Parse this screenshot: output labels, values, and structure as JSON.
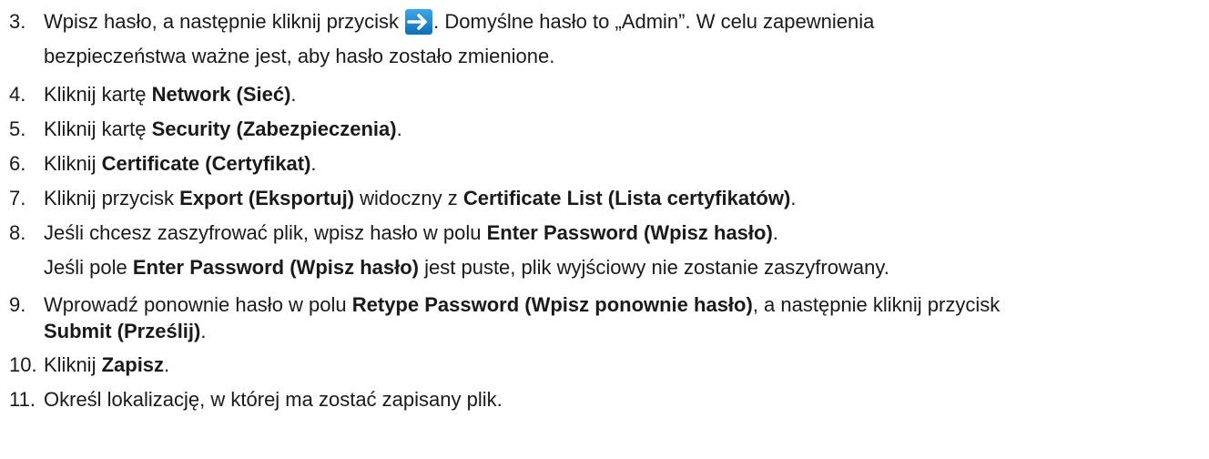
{
  "steps": [
    {
      "num": "3.",
      "a": "Wpisz hasło, a następnie kliknij przycisk ",
      "icon": "arrow-right-icon",
      "b": ". Domyślne hasło to „Admin”. W celu zapewnienia",
      "cont": "bezpieczeństwa ważne jest, aby hasło zostało zmienione."
    },
    {
      "num": "4.",
      "a": "Kliknij kartę ",
      "b1": "Network (Sieć)",
      "c": "."
    },
    {
      "num": "5.",
      "a": "Kliknij kartę ",
      "b1": "Security (Zabezpieczenia)",
      "c": "."
    },
    {
      "num": "6.",
      "a": "Kliknij ",
      "b1": "Certificate (Certyfikat)",
      "c": "."
    },
    {
      "num": "7.",
      "a": "Kliknij przycisk ",
      "b1": "Export (Eksportuj)",
      "c": " widoczny z ",
      "b2": "Certificate List (Lista certyfikatów)",
      "d": "."
    },
    {
      "num": "8.",
      "a": "Jeśli chcesz zaszyfrować plik, wpisz hasło w polu ",
      "b1": "Enter Password (Wpisz hasło)",
      "c": ".",
      "cont_a": "Jeśli pole ",
      "cont_b": "Enter Password (Wpisz hasło)",
      "cont_c": " jest puste, plik wyjściowy nie zostanie zaszyfrowany."
    },
    {
      "num": "9.",
      "a": "Wprowadź ponownie hasło w polu ",
      "b1": "Retype Password (Wpisz ponownie hasło)",
      "c": ", a następnie kliknij przycisk",
      "b2": "Submit (Prześlij)",
      "d": "."
    },
    {
      "num": "10.",
      "a": "Kliknij ",
      "b1": "Zapisz",
      "c": "."
    },
    {
      "num": "11.",
      "a": "Określ lokalizację, w której ma zostać zapisany plik."
    }
  ]
}
